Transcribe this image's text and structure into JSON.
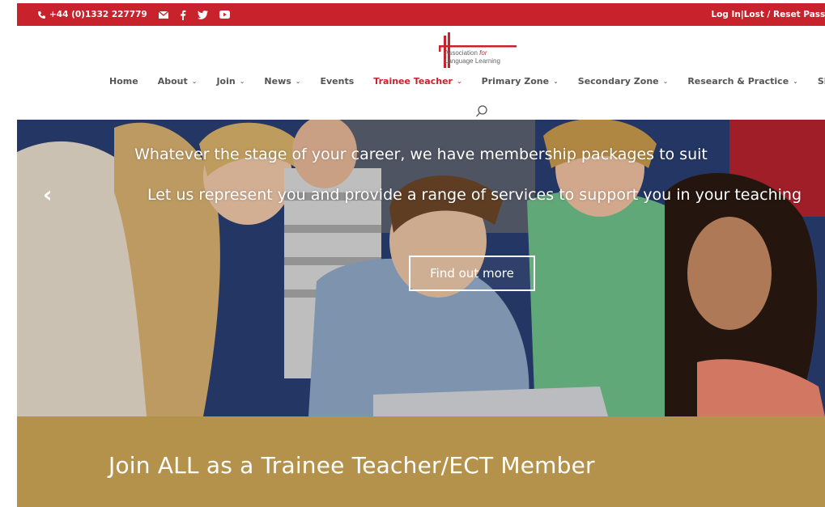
{
  "topbar": {
    "phone": "+44 (0)1332 227779",
    "icons": [
      "phone-icon",
      "mail-icon",
      "facebook-icon",
      "twitter-icon",
      "youtube-icon"
    ],
    "login": "Log In",
    "separator": " | ",
    "reset": "Lost / Reset Passw"
  },
  "logo": {
    "line1": "Association ",
    "for": "for",
    "line2": "Language Learning"
  },
  "nav": [
    {
      "label": "Home",
      "dropdown": false
    },
    {
      "label": "About",
      "dropdown": true
    },
    {
      "label": "Join",
      "dropdown": true
    },
    {
      "label": "News",
      "dropdown": true
    },
    {
      "label": "Events",
      "dropdown": false
    },
    {
      "label": "Trainee Teacher",
      "dropdown": true,
      "active": true
    },
    {
      "label": "Primary Zone",
      "dropdown": true
    },
    {
      "label": "Secondary Zone",
      "dropdown": true
    },
    {
      "label": "Research & Practice",
      "dropdown": true
    },
    {
      "label": "Shop",
      "dropdown": false
    }
  ],
  "hero": {
    "heading": "Whatever the stage of your career, we have membership packages to suit",
    "subheading": "Let us represent you and provide a range of services to support you in your teaching",
    "button": "Find out more",
    "prev_icon": "chevron-left-icon"
  },
  "band": {
    "title": "Join ALL as a Trainee Teacher/ECT Member"
  },
  "colors": {
    "brand_red": "#c8222c",
    "band_gold": "#b4924c",
    "nav_text": "#555555"
  }
}
